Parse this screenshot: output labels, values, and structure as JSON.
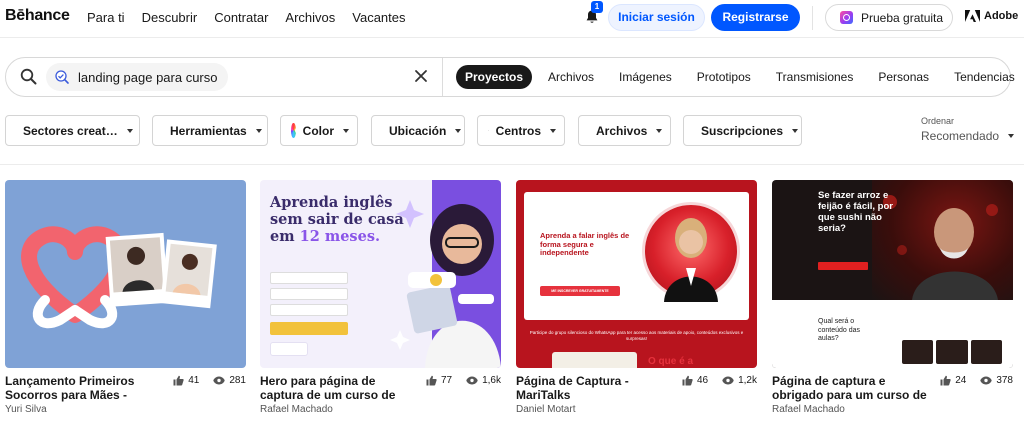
{
  "header": {
    "logo": "Bēhance",
    "nav": [
      "Para ti",
      "Descubrir",
      "Contratar",
      "Archivos",
      "Vacantes"
    ],
    "notification_count": "1",
    "login_label": "Iniciar sesión",
    "register_label": "Registrarse",
    "trial_label": "Prueba gratuita",
    "adobe_label": "Adobe"
  },
  "search": {
    "query": "landing page para curso",
    "tabs": [
      "Proyectos",
      "Archivos",
      "Imágenes",
      "Prototipos",
      "Transmisiones",
      "Personas",
      "Tendencias"
    ],
    "active_tab": "Proyectos"
  },
  "filters": {
    "items": [
      {
        "label": "Sectores creat…",
        "icon": "briefcase-icon"
      },
      {
        "label": "Herramientas",
        "icon": "tools-icon"
      },
      {
        "label": "Color",
        "icon": "color-wheel-icon"
      },
      {
        "label": "Ubicación",
        "icon": "location-pin-icon"
      },
      {
        "label": "Centros",
        "icon": "graduation-cap-icon"
      },
      {
        "label": "Archivos",
        "icon": "paperclip-icon"
      },
      {
        "label": "Suscripciones",
        "icon": "lock-person-icon"
      }
    ],
    "order_label": "Ordenar",
    "order_value": "Recomendado"
  },
  "projects": [
    {
      "title": "Lançamento Primeiros Socorros para Mães - Samia",
      "author": "Yuri Silva",
      "likes": "41",
      "views": "281"
    },
    {
      "title": "Hero para página de captura de um curso de",
      "author": "Rafael Machado",
      "likes": "77",
      "views": "1,6k",
      "thumb": {
        "heading_1": "Aprenda inglês",
        "heading_2": "sem sair de casa",
        "heading_3_prefix": "em",
        "heading_3_highlight": "12 meses."
      }
    },
    {
      "title": "Página de Captura - MariTalks",
      "author": "Daniel Motart",
      "likes": "46",
      "views": "1,2k",
      "thumb": {
        "heading": "Aprenda a falar inglês de forma segura e independente",
        "cta": "ME INSCREVER GRATUITAMENTE",
        "band": "Participe do grupo silencioso do WhatsApp para ter acesso aos materiais de apoio, conteúdos exclusivos e surpresas!",
        "bottom_text": "O que é a"
      }
    },
    {
      "title": "Página de captura e obrigado para um curso de",
      "author": "Rafael Machado",
      "likes": "24",
      "views": "378",
      "thumb": {
        "heading": "Se fazer arroz e feijão é fácil, por que sushi não seria?",
        "question": "Qual será o conteúdo das aulas?"
      }
    }
  ],
  "colors": {
    "accent": "#0057ff",
    "text": "#191919"
  }
}
